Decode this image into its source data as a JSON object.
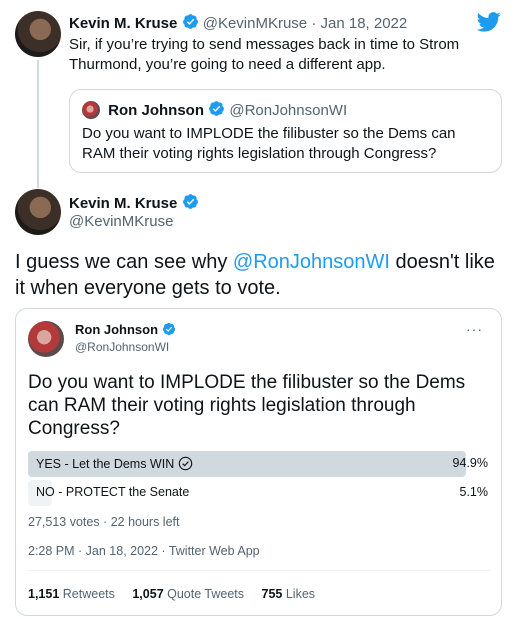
{
  "tweet1": {
    "name": "Kevin M. Kruse",
    "handle": "@KevinMKruse",
    "separator": "·",
    "date": "Jan 18, 2022",
    "text": "Sir, if you’re trying to send messages back in time to Strom Thurmond, you’re going to need a different app.",
    "quote": {
      "name": "Ron Johnson",
      "handle": "@RonJohnsonWI",
      "text": "Do you want to IMPLODE the filibuster so the Dems can RAM their voting rights legislation through Congress?"
    }
  },
  "tweet2": {
    "name": "Kevin M. Kruse",
    "handle": "@KevinMKruse",
    "text_before": "I guess we can see why ",
    "mention": "@RonJohnsonWI",
    "text_after": " doesn't like it when everyone gets to vote."
  },
  "embed": {
    "name": "Ron Johnson",
    "handle": "@RonJohnsonWI",
    "more": "···",
    "question": "Do you want to IMPLODE the filibuster so the Dems can RAM their voting rights legislation through Congress?",
    "poll": [
      {
        "label": "YES - Let the Dems WIN",
        "percent_text": "94.9%",
        "percent": 94.9,
        "winner": true
      },
      {
        "label": "NO - PROTECT the Senate",
        "percent_text": "5.1%",
        "percent": 5.1,
        "winner": false
      }
    ],
    "poll_meta": "27,513 votes · 22 hours left",
    "timestamp": "2:28 PM · Jan 18, 2022 · Twitter Web App",
    "stats": {
      "retweets_count": "1,151",
      "retweets_label": "Retweets",
      "quotes_count": "1,057",
      "quotes_label": "Quote Tweets",
      "likes_count": "755",
      "likes_label": "Likes"
    }
  },
  "colors": {
    "accent": "#1d9bf0",
    "text": "#0f1419",
    "muted": "#536471",
    "border": "#cfd9de"
  }
}
